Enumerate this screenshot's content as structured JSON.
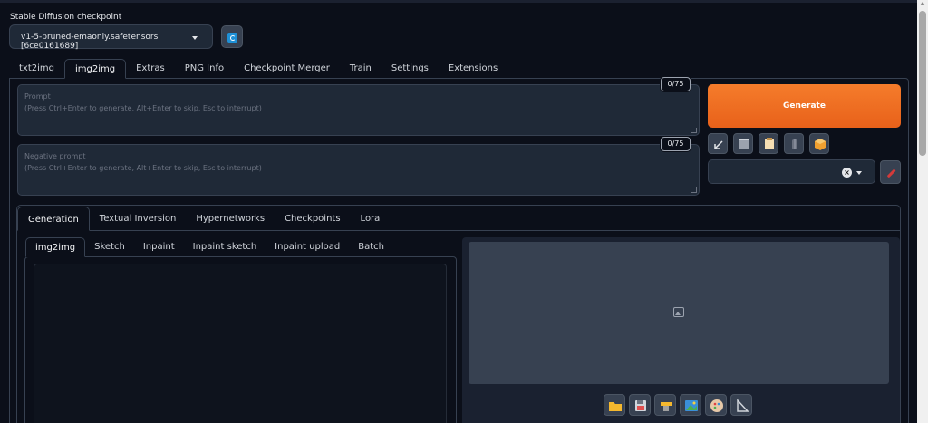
{
  "checkpoint": {
    "label": "Stable Diffusion checkpoint",
    "selected": "v1-5-pruned-emaonly.safetensors [6ce0161689]"
  },
  "main_tabs": [
    {
      "label": "txt2img"
    },
    {
      "label": "img2img"
    },
    {
      "label": "Extras"
    },
    {
      "label": "PNG Info"
    },
    {
      "label": "Checkpoint Merger"
    },
    {
      "label": "Train"
    },
    {
      "label": "Settings"
    },
    {
      "label": "Extensions"
    }
  ],
  "active_main_tab": "img2img",
  "prompt": {
    "label": "Prompt",
    "placeholder": "(Press Ctrl+Enter to generate, Alt+Enter to skip, Esc to interrupt)",
    "token_count": "0/75"
  },
  "negative_prompt": {
    "label": "Negative prompt",
    "placeholder": "(Press Ctrl+Enter to generate, Alt+Enter to skip, Esc to interrupt)",
    "token_count": "0/75"
  },
  "generate": {
    "label": "Generate"
  },
  "tool_buttons": [
    "read-params-icon",
    "trash-icon",
    "clipboard-icon",
    "show-extra-networks-icon",
    "save-style-icon"
  ],
  "styles": {
    "value": ""
  },
  "sub_tabs": [
    {
      "label": "Generation"
    },
    {
      "label": "Textual Inversion"
    },
    {
      "label": "Hypernetworks"
    },
    {
      "label": "Checkpoints"
    },
    {
      "label": "Lora"
    }
  ],
  "img_tabs": [
    {
      "label": "img2img"
    },
    {
      "label": "Sketch"
    },
    {
      "label": "Inpaint"
    },
    {
      "label": "Inpaint sketch"
    },
    {
      "label": "Inpaint upload"
    },
    {
      "label": "Batch"
    }
  ],
  "output_buttons": [
    "folder-icon",
    "save-icon",
    "zip-icon",
    "send-to-img2img-icon",
    "send-to-inpaint-icon",
    "send-to-extras-icon"
  ],
  "colors": {
    "background": "#0b0f19",
    "generate": "#f26e21",
    "panel": "#1f2937"
  }
}
